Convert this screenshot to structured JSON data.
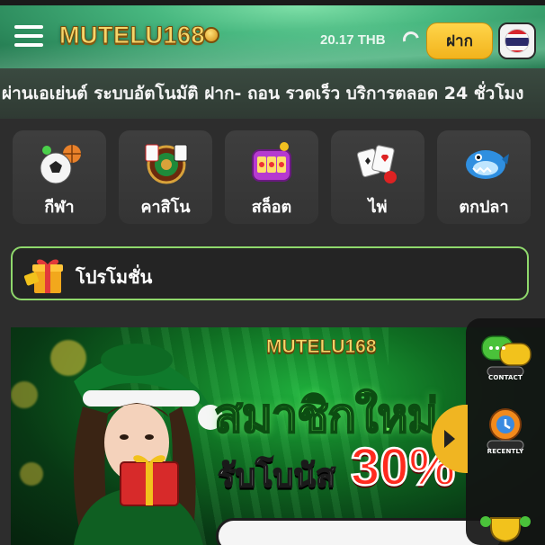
{
  "header": {
    "logo_text": "MUTELU168",
    "balance": "20.17 THB",
    "deposit_label": "ฝาก",
    "language_flag": "thailand-flag-icon"
  },
  "announcement": {
    "text": "ผ่านเอเย่นต์ ระบบอัตโนมัติ ฝาก- ถอน รวดเร็ว บริการตลอด 24 ชั่วโมง"
  },
  "categories": [
    {
      "label": "กีฬา",
      "icon": "sports-ball-icon"
    },
    {
      "label": "คาสิโน",
      "icon": "roulette-icon"
    },
    {
      "label": "สล็อต",
      "icon": "slot-machine-icon"
    },
    {
      "label": "ไพ่",
      "icon": "playing-cards-icon"
    },
    {
      "label": "ตกปลา",
      "icon": "fish-game-icon"
    }
  ],
  "promo": {
    "label": "โปรโมชั่น",
    "icon": "gift-icon"
  },
  "banner": {
    "logo_text": "MUTELU168",
    "headline": "สมาชิกใหม่",
    "subline": "รับโบนัส",
    "percent": "30%"
  },
  "side_panel": {
    "items": [
      {
        "label": "CONTACT",
        "icon": "chat-bubbles-icon"
      },
      {
        "label": "RECENTLY",
        "icon": "recent-games-icon"
      },
      {
        "label": "",
        "icon": "trophy-icon"
      }
    ]
  },
  "colors": {
    "header_green": "#48b880",
    "deposit_yellow": "#f2b31c",
    "promo_border": "#8fd86c",
    "banner_green": "#1fae3c",
    "percent_red": "#ff2a1e"
  }
}
